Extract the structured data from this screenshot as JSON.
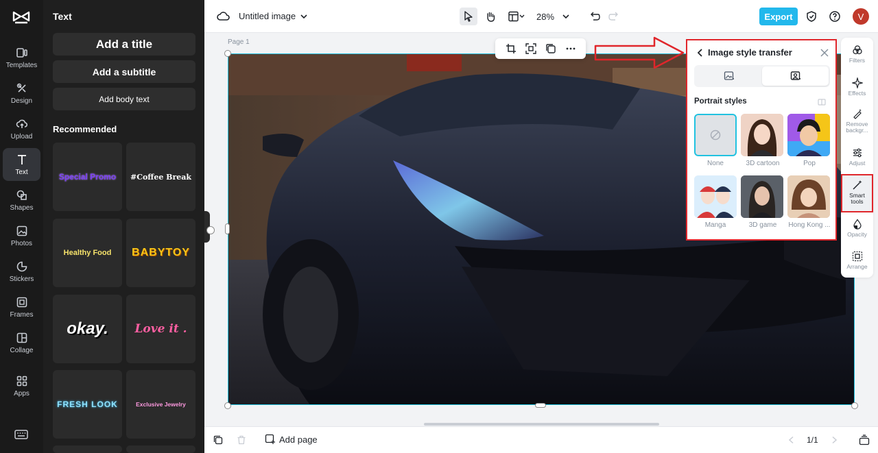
{
  "rail": {
    "items": [
      {
        "label": "Templates"
      },
      {
        "label": "Design"
      },
      {
        "label": "Upload"
      },
      {
        "label": "Text"
      },
      {
        "label": "Shapes"
      },
      {
        "label": "Photos"
      },
      {
        "label": "Stickers"
      },
      {
        "label": "Frames"
      },
      {
        "label": "Collage"
      },
      {
        "label": "Apps"
      }
    ]
  },
  "panel": {
    "title": "Text",
    "add_title": "Add a title",
    "add_subtitle": "Add a subtitle",
    "add_body": "Add body text",
    "recommended": "Recommended",
    "presets": [
      {
        "text": "Special Promo",
        "color": "#7b3ff2"
      },
      {
        "text": "#Coffee Break",
        "color": "#ffffff"
      },
      {
        "text": "Healthy Food",
        "color": "#f7e36b"
      },
      {
        "text": "BABYTOY",
        "color": "#f5c518"
      },
      {
        "text": "okay.",
        "color": "#ffffff"
      },
      {
        "text": "Love it .",
        "color": "#ff5fa2"
      },
      {
        "text": "FRESH LOOK",
        "color": "#8fe3ff"
      },
      {
        "text": "Exclusive Jewelry",
        "color": "#ff9ae0"
      }
    ]
  },
  "topbar": {
    "doc_title": "Untitled image",
    "zoom": "28%",
    "export": "Export",
    "avatar_letter": "V"
  },
  "canvas": {
    "page_label": "Page 1"
  },
  "style_transfer": {
    "title": "Image style transfer",
    "section": "Portrait styles",
    "styles": [
      {
        "label": "None"
      },
      {
        "label": "3D cartoon"
      },
      {
        "label": "Pop"
      },
      {
        "label": "Manga"
      },
      {
        "label": "3D game"
      },
      {
        "label": "Hong Kong ..."
      }
    ]
  },
  "right_rail": {
    "items": [
      {
        "label": "Filters"
      },
      {
        "label": "Effects"
      },
      {
        "label": "Remove backgr..."
      },
      {
        "label": "Adjust"
      },
      {
        "label": "Smart tools"
      },
      {
        "label": "Opacity"
      },
      {
        "label": "Arrange"
      }
    ]
  },
  "bottombar": {
    "add_page": "Add page",
    "page_count": "1/1"
  },
  "colors": {
    "accent": "#22b8ec",
    "annotation": "#e0262b",
    "selection": "#21c2e0"
  }
}
